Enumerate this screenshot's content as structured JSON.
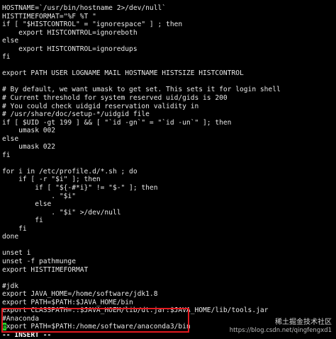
{
  "terminal": {
    "lines": [
      "HOSTNAME=`/usr/bin/hostname 2>/dev/null`",
      "HISTTIMEFORMAT=\"%F %T \"",
      "if [ \"$HISTCONTROL\" = \"ignorespace\" ] ; then",
      "    export HISTCONTROL=ignoreboth",
      "else",
      "    export HISTCONTROL=ignoredups",
      "fi",
      "",
      "export PATH USER LOGNAME MAIL HOSTNAME HISTSIZE HISTCONTROL",
      "",
      "# By default, we want umask to get set. This sets it for login shell",
      "# Current threshold for system reserved uid/gids is 200",
      "# You could check uidgid reservation validity in",
      "# /usr/share/doc/setup-*/uidgid file",
      "if [ $UID -gt 199 ] && [ \"`id -gn`\" = \"`id -un`\" ]; then",
      "    umask 002",
      "else",
      "    umask 022",
      "fi",
      "",
      "for i in /etc/profile.d/*.sh ; do",
      "    if [ -r \"$i\" ]; then",
      "        if [ \"${-#*i}\" != \"$-\" ]; then",
      "            . \"$i\"",
      "        else",
      "            . \"$i\" >/dev/null",
      "        fi",
      "    fi",
      "done",
      "",
      "unset i",
      "unset -f pathmunge",
      "export HISTTIMEFORMAT",
      "",
      "#jdk",
      "export JAVA_HOME=/home/software/jdk1.8",
      "export PATH=$PATH:$JAVA_HOME/bin",
      "export CLASSPATH=.:$JAVA_HOEM/lib/dt.jar:$JAVA_HOME/lib/tools.jar",
      "#Anaconda"
    ],
    "cursor_line": {
      "cursor_char": "e",
      "rest": "xport PATH=$PATH:/home/software/anaconda3/bin"
    },
    "mode_indicator": "-- INSERT --"
  },
  "watermark": {
    "brand": "稀土掘金技术社区",
    "url": "https://blog.csdn.net/qingfengxd1"
  },
  "colors": {
    "background": "#000000",
    "text": "#e8e8e8",
    "cursor": "#2bd12b",
    "highlight_border": "#e0191f"
  }
}
